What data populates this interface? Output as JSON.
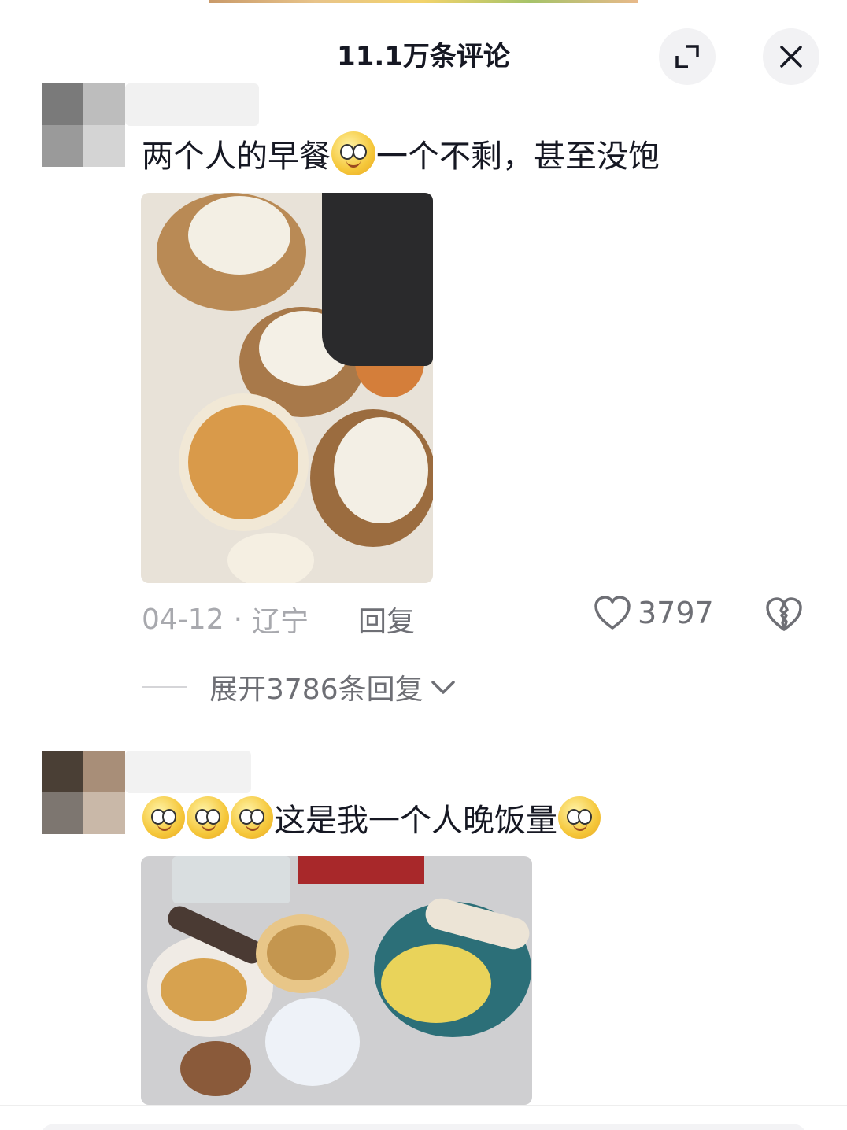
{
  "header": {
    "title": "11.1万条评论"
  },
  "comments": [
    {
      "text_before": "两个人的早餐",
      "text_after": "一个不剩，甚至没饱",
      "date": "04-12",
      "separator": "·",
      "location": "辽宁",
      "reply_label": "回复",
      "like_count": "3797",
      "expand_replies_label": "展开3786条回复"
    },
    {
      "text_main": "这是我一个人晚饭量"
    }
  ],
  "colors": {
    "primary_text": "#161823",
    "secondary_text": "#6e6f75",
    "meta_text": "#a8a9ae",
    "button_bg": "#f2f2f4"
  },
  "icons": [
    "expand-icon",
    "close-icon",
    "heart-icon",
    "broken-heart-icon",
    "chevron-down-icon"
  ]
}
